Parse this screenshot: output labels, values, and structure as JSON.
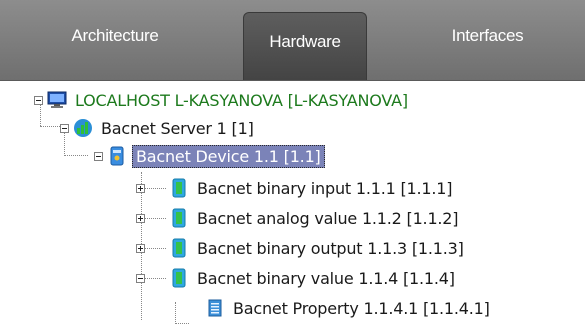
{
  "tabs": [
    {
      "label": "Architecture",
      "active": false
    },
    {
      "label": "Hardware",
      "active": true
    },
    {
      "label": "Interfaces",
      "active": false
    }
  ],
  "tree": {
    "host": {
      "label": "LOCALHOST L-KASYANOVA [L-KASYANOVA]",
      "icon": "computer-icon",
      "color": "#1d7a1d"
    },
    "server": {
      "label": "Bacnet Server 1 [1]",
      "icon": "bacnet-server-icon"
    },
    "device": {
      "label": "Bacnet Device 1.1 [1.1]",
      "icon": "bacnet-device-icon",
      "selected": true
    },
    "objects": [
      {
        "label": "Bacnet binary input 1.1.1 [1.1.1]",
        "icon": "bacnet-object-icon",
        "expander": "plus"
      },
      {
        "label": "Bacnet analog value 1.1.2 [1.1.2]",
        "icon": "bacnet-object-icon",
        "expander": "plus"
      },
      {
        "label": "Bacnet binary output 1.1.3 [1.1.3]",
        "icon": "bacnet-object-icon",
        "expander": "plus"
      },
      {
        "label": "Bacnet binary value 1.1.4 [1.1.4]",
        "icon": "bacnet-object-icon",
        "expander": "minus"
      }
    ],
    "property": {
      "label": "Bacnet Property 1.1.4.1 [1.1.4.1]",
      "icon": "bacnet-property-icon"
    }
  },
  "colors": {
    "tabbar": "#7d7d7d",
    "selection": "#7b83b8",
    "host_text": "#1d7a1d"
  }
}
